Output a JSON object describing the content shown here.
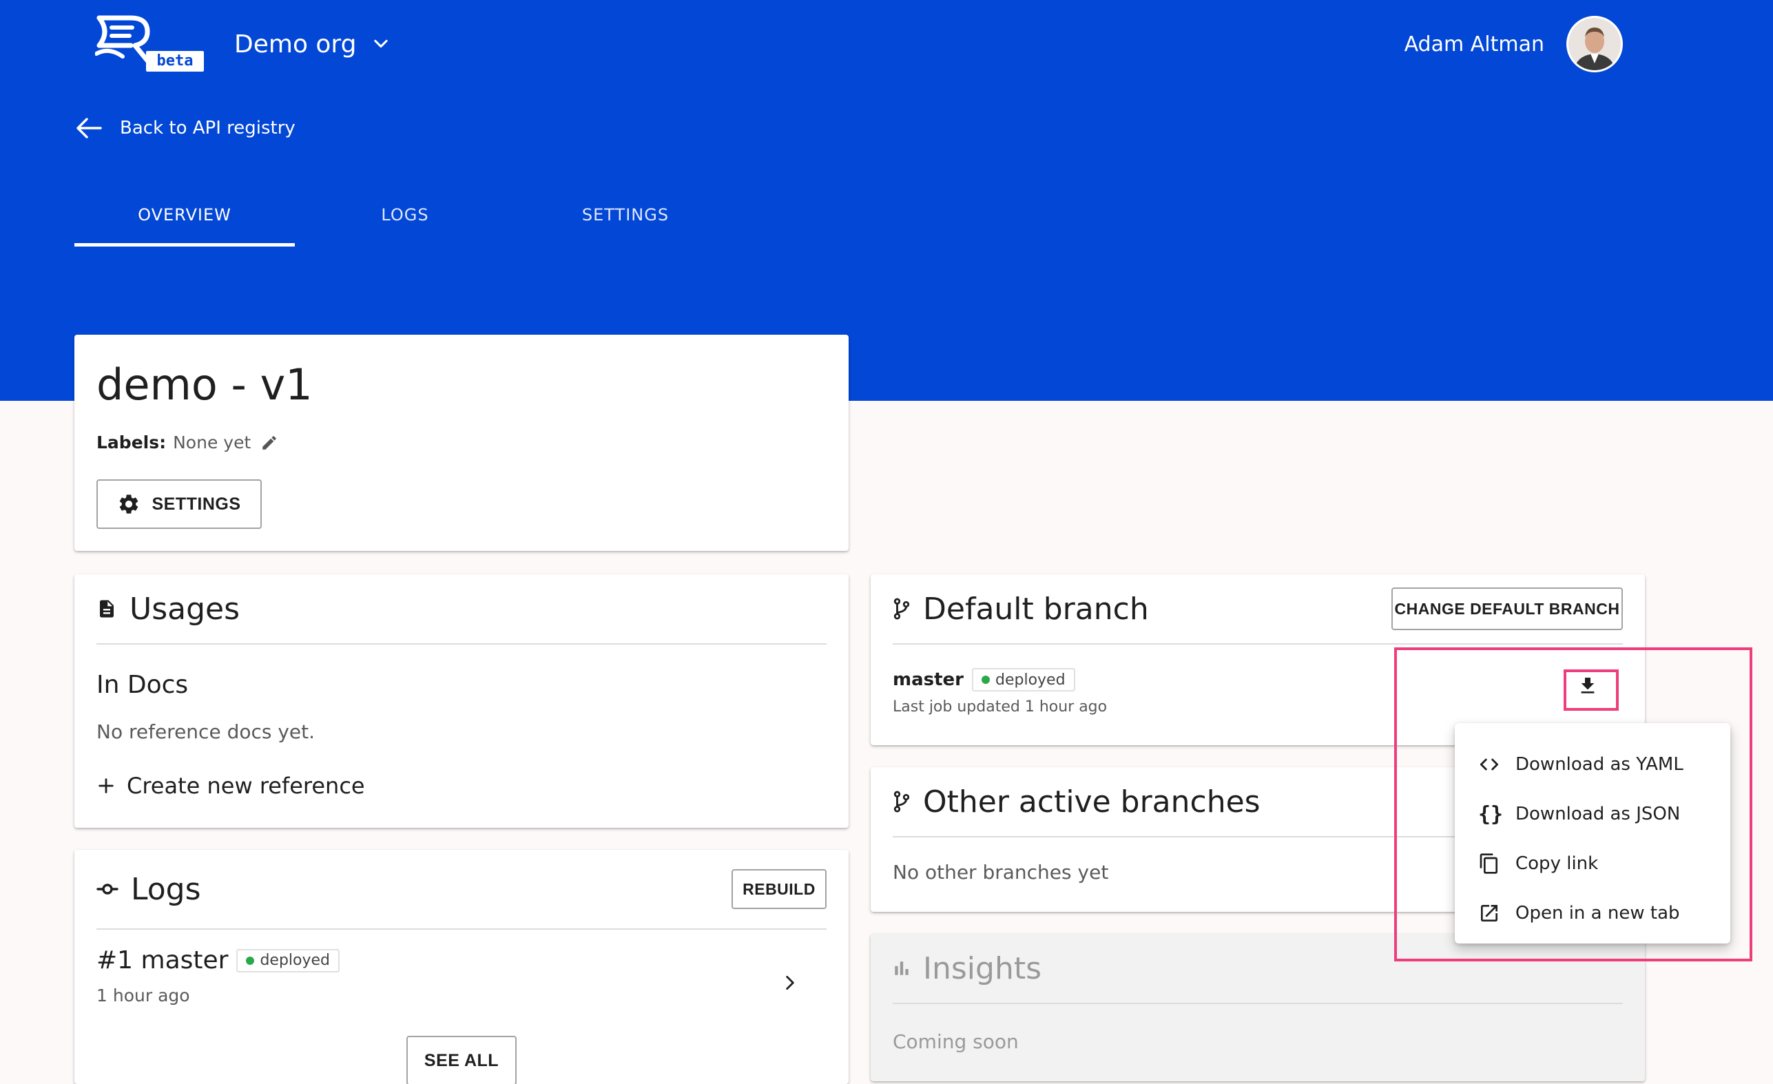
{
  "header": {
    "brand_badge": "beta",
    "org_name": "Demo org",
    "user_name": "Adam Altman",
    "back_label": "Back to API registry"
  },
  "tabs": [
    {
      "label": "OVERVIEW",
      "active": true
    },
    {
      "label": "LOGS",
      "active": false
    },
    {
      "label": "SETTINGS",
      "active": false
    }
  ],
  "api": {
    "title": "demo - v1",
    "labels_key": "Labels:",
    "labels_value": "None yet",
    "settings_button": "SETTINGS"
  },
  "usages": {
    "title": "Usages",
    "section_title": "In Docs",
    "empty_text": "No reference docs yet.",
    "create_label": "Create new reference"
  },
  "logs": {
    "title": "Logs",
    "rebuild_button": "REBUILD",
    "entry_title": "#1 master",
    "entry_status": "deployed",
    "entry_time": "1 hour ago",
    "see_all_button": "SEE ALL"
  },
  "default_branch": {
    "title": "Default branch",
    "change_button": "CHANGE DEFAULT BRANCH",
    "branch_name": "master",
    "status": "deployed",
    "last_job": "Last job updated 1 hour ago"
  },
  "other_branches": {
    "title": "Other active branches",
    "empty_text": "No other branches yet"
  },
  "insights": {
    "title": "Insights",
    "subtitle": "Coming soon"
  },
  "download_menu": {
    "items": [
      {
        "label": "Download as YAML",
        "icon": "code-icon"
      },
      {
        "label": "Download as JSON",
        "icon": "braces-icon"
      },
      {
        "label": "Copy link",
        "icon": "copy-icon"
      },
      {
        "label": "Open in a new tab",
        "icon": "open-in-new-icon"
      }
    ]
  },
  "colors": {
    "header_bg": "#0247d5",
    "highlight": "#ee3d7c",
    "status_green": "#2aa84a"
  }
}
